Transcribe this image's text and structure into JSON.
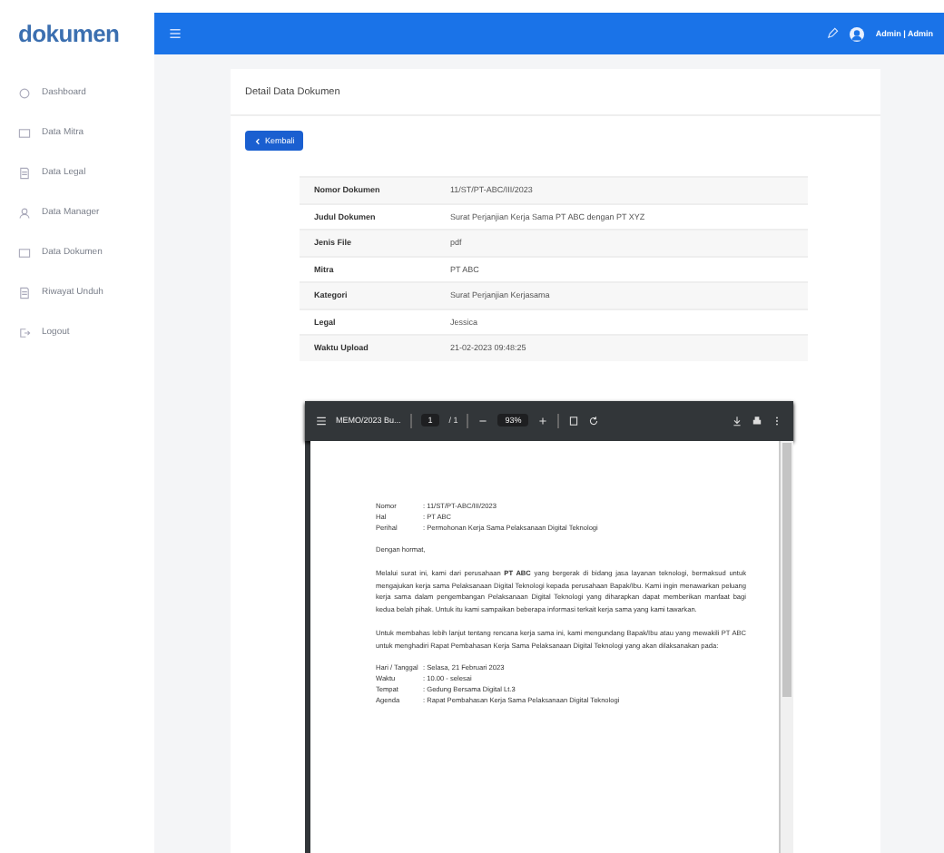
{
  "app": {
    "logo": "dokumen",
    "user": "Admin | Admin"
  },
  "sidebar": {
    "items": [
      {
        "label": "Dashboard",
        "selected": false
      },
      {
        "label": "Data Mitra",
        "selected": false
      },
      {
        "label": "Data Legal",
        "selected": false
      },
      {
        "label": "Data Manager",
        "selected": false
      },
      {
        "label": "Data Dokumen",
        "selected": false
      },
      {
        "label": "Riwayat Unduh",
        "selected": false
      },
      {
        "label": "Logout",
        "selected": false
      }
    ]
  },
  "page": {
    "title": "Detail Data Dokumen",
    "back_button": "Kembali"
  },
  "details": [
    {
      "label": "Nomor Dokumen",
      "value": "11/ST/PT-ABC/III/2023"
    },
    {
      "label": "Judul Dokumen",
      "value": "Surat Perjanjian Kerja Sama PT ABC dengan PT XYZ"
    },
    {
      "label": "Jenis File",
      "value": "pdf"
    },
    {
      "label": "Mitra",
      "value": "PT ABC"
    },
    {
      "label": "Kategori",
      "value": "Surat Perjanjian Kerjasama"
    },
    {
      "label": "Legal",
      "value": "Jessica"
    },
    {
      "label": "Waktu Upload",
      "value": "21-02-2023 09:48:25"
    }
  ],
  "pdf_viewer": {
    "file_name": "MEMO/2023 Bu...",
    "page": "1",
    "page_count": "/ 1",
    "zoom": "93%",
    "document": [
      {
        "kind": "meta",
        "rows": [
          {
            "label": "Nomor",
            "value": ": 11/ST/PT-ABC/III/2023"
          },
          {
            "label": "Hal",
            "value": ": PT ABC"
          },
          {
            "label": "Perihal",
            "value": ": Permohonan Kerja Sama Pelaksanaan Digital Teknologi"
          }
        ]
      },
      {
        "kind": "para",
        "text": "Dengan hormat,"
      },
      {
        "kind": "para",
        "text": "Melalui surat ini, kami dari perusahaan **PT ABC** yang bergerak di bidang jasa layanan teknologi, bermaksud untuk mengajukan kerja sama Pelaksanaan Digital Teknologi kepada perusahaan Bapak/Ibu. Kami ingin menawarkan peluang kerja sama dalam pengembangan Pelaksanaan Digital Teknologi yang diharapkan dapat memberikan manfaat bagi kedua belah pihak. Untuk itu kami sampaikan beberapa informasi terkait kerja sama yang kami tawarkan."
      },
      {
        "kind": "para",
        "text": "Untuk membahas lebih lanjut tentang rencana kerja sama ini, kami mengundang Bapak/Ibu atau yang mewakili PT ABC untuk menghadiri Rapat Pembahasan Kerja Sama Pelaksanaan Digital Teknologi yang akan dilaksanakan pada:"
      },
      {
        "kind": "meta",
        "rows": [
          {
            "label": "Hari / Tanggal",
            "value": ": Selasa, 21 Februari 2023"
          },
          {
            "label": "Waktu",
            "value": ": 10.00 - selesai"
          },
          {
            "label": "Tempat",
            "value": ": Gedung Bersama Digital Lt.3"
          },
          {
            "label": "Agenda",
            "value": ": Rapat Pembahasan Kerja Sama Pelaksanaan Digital Teknologi"
          }
        ]
      }
    ]
  }
}
